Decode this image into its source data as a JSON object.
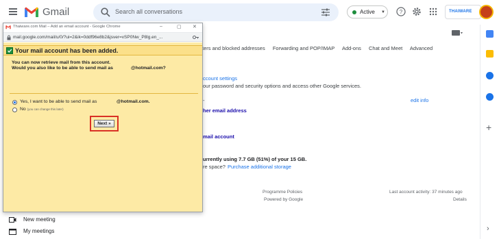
{
  "app": {
    "name": "Gmail"
  },
  "search": {
    "placeholder": "Search all conversations"
  },
  "status": {
    "label": "Active"
  },
  "brand": {
    "text": "THAIWARE"
  },
  "settings": {
    "tabs": [
      "ters and blocked addresses",
      "Forwarding and POP/IMAP",
      "Add-ons",
      "Chat and Meet",
      "Advanced"
    ],
    "account_settings_link": "ccount settings",
    "account_settings_desc": "our password and security options and access other Google services.",
    "edit_info": "edit info",
    "other_email_link": "her email address",
    "mail_account_link": "mail account",
    "storage_text": "urrently using 7.7 GB (51%) of your 15 GB.",
    "storage_question": "re space?",
    "storage_link": "Purchase additional storage",
    "footer_policies": "Programme Policies",
    "footer_powered": "Powered by Google",
    "footer_activity": "Last account activity: 37 minutes ago",
    "footer_details": "Details",
    "dash": "-"
  },
  "left_nav": {
    "new_meeting": "New meeting",
    "my_meetings": "My meetings"
  },
  "popup": {
    "window_title": "Thaiware.com Mail – Add an email account - Google Chrome",
    "url": "mail.google.com/mail/u/0/?ui=2&ik=0ddf96e8b2&jsver=vSP0Nw_P8lg.en_...",
    "added_title": "Your mail account has been added.",
    "question_line1": "You can now retrieve mail from this account.",
    "question_line2": "Would you also like to be able to send mail as",
    "question_email": "@hotmail.com?",
    "yes_option": "Yes, I want to be able to send mail as",
    "yes_email": "@hotmail.com.",
    "no_option": "No",
    "no_note": "(you can change this later)",
    "next_button": "Next »"
  },
  "colors": {
    "accent": "#1a73e8",
    "highlight_border": "#d93025",
    "popup_bg": "#fdeaa5",
    "status_green": "#1e8e3e"
  }
}
